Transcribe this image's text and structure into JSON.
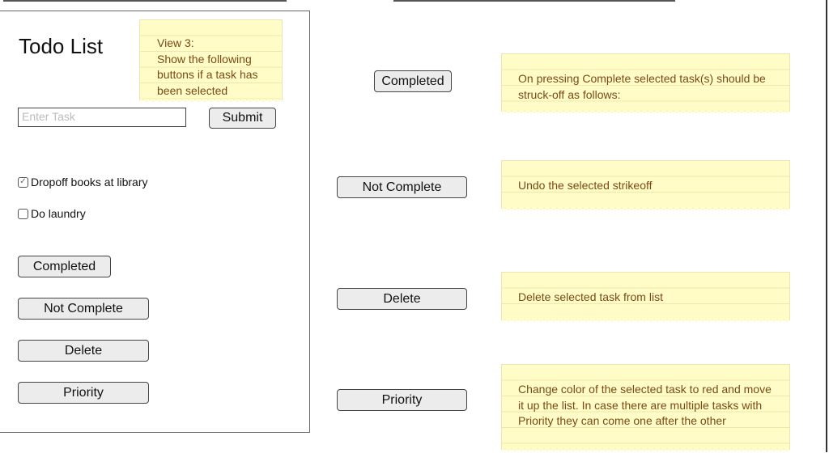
{
  "app": {
    "title": "Todo List",
    "input": {
      "placeholder": "Enter Task",
      "value": ""
    },
    "submit_label": "Submit",
    "tasks": [
      {
        "label": "Dropoff books at library",
        "checked": true
      },
      {
        "label": "Do laundry",
        "checked": false
      }
    ],
    "buttons": {
      "completed": "Completed",
      "not_complete": "Not Complete",
      "delete": "Delete",
      "priority": "Priority"
    }
  },
  "view_note": "View 3:\nShow the following buttons if a task has been selected",
  "annotations": [
    {
      "button": "Completed",
      "note": "On pressing Complete selected task(s) should be struck-off as follows:"
    },
    {
      "button": "Not Complete",
      "note": "Undo the selected strikeoff"
    },
    {
      "button": "Delete",
      "note": "Delete selected task from list"
    },
    {
      "button": "Priority",
      "note": "Change color of the selected task to red and move it up the list. In case there are multiple tasks with Priority they can come one after the other"
    }
  ],
  "colors": {
    "note_bg": "#fffcc8",
    "note_text": "#7a4a14",
    "button_bg": "#ececec"
  }
}
